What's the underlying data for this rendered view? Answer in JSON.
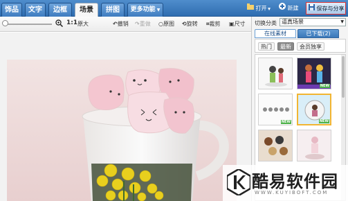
{
  "tabs": [
    "饰品",
    "文字",
    "边框",
    "场景",
    "拼图",
    "更多功能"
  ],
  "active_tab": "场景",
  "topbar": {
    "open_label": "打开",
    "new_label": "新建",
    "save_share_label": "保存与分享"
  },
  "toolbar": {
    "zoom_text": "1:1",
    "original_size": "原大",
    "undo": "撤销",
    "redo": "重做",
    "original_image": "原图",
    "rotate": "旋转",
    "crop": "裁剪",
    "size": "尺寸"
  },
  "right_panel": {
    "category_label": "切换分类",
    "category_value": "逼真场景",
    "tab_online": "在线素材",
    "tab_downloaded": "已下载(2)",
    "subtabs": [
      "热门",
      "最新",
      "会员独享"
    ],
    "active_subtab": "最新",
    "new_badge": "NEW"
  },
  "watermark": {
    "text": "酷易软件园",
    "url": "WWW.KUYIBOFT.COM"
  },
  "colors": {
    "topbar": "#3a78bd",
    "accent_border": "#d33333",
    "selected_thumb": "#f2b531",
    "new_badge": "#4db24a"
  }
}
